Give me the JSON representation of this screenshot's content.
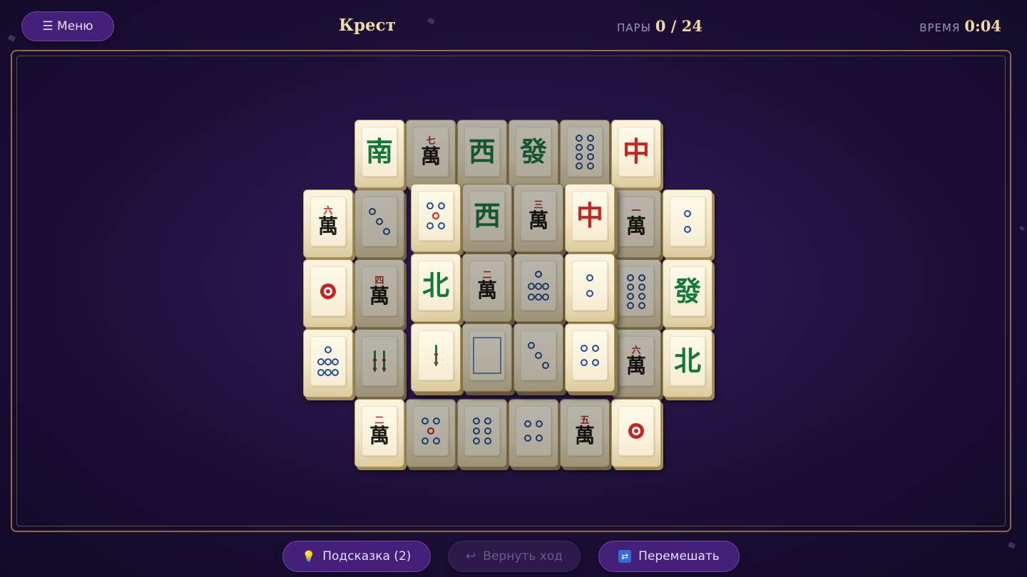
{
  "header": {
    "menu_label": "☰  Меню",
    "title": "Крест",
    "pairs_label": "ПАРЫ",
    "pairs_value": "0 / 24",
    "time_label": "ВРЕМЯ",
    "time_value": "0:04"
  },
  "controls": {
    "hint_icon": "💡",
    "hint_label": "Подсказка (2)",
    "undo_icon": "↩",
    "undo_label": "Вернуть ход",
    "shuffle_icon": "🔀",
    "shuffle_label": "Перемешать"
  },
  "tiles": [
    {
      "col": 1,
      "row": 0,
      "kind": "honor",
      "glyph": "南",
      "color": "green",
      "dim": false
    },
    {
      "col": 2,
      "row": 0,
      "kind": "char",
      "num": "七",
      "dim": true
    },
    {
      "col": 3,
      "row": 0,
      "kind": "honor",
      "glyph": "西",
      "color": "green",
      "dim": true
    },
    {
      "col": 4,
      "row": 0,
      "kind": "honor",
      "glyph": "發",
      "color": "green",
      "dim": true
    },
    {
      "col": 5,
      "row": 0,
      "kind": "dots",
      "n": 8,
      "dim": true
    },
    {
      "col": 6,
      "row": 0,
      "kind": "honor",
      "glyph": "中",
      "color": "red",
      "dim": false
    },
    {
      "col": 0,
      "row": 1,
      "kind": "char",
      "num": "六",
      "dim": false
    },
    {
      "col": 1,
      "row": 1,
      "kind": "dots",
      "n": 3,
      "dim": true
    },
    {
      "col": 6,
      "row": 1,
      "kind": "char",
      "num": "一",
      "dim": true
    },
    {
      "col": 7,
      "row": 1,
      "kind": "dots",
      "n": 2,
      "dim": false
    },
    {
      "col": 0,
      "row": 2,
      "kind": "dots",
      "n": 1,
      "dim": false
    },
    {
      "col": 1,
      "row": 2,
      "kind": "char",
      "num": "四",
      "dim": true
    },
    {
      "col": 6,
      "row": 2,
      "kind": "dots",
      "n": 8,
      "dim": true
    },
    {
      "col": 7,
      "row": 2,
      "kind": "honor",
      "glyph": "發",
      "color": "green",
      "dim": false
    },
    {
      "col": 0,
      "row": 3,
      "kind": "dots",
      "n": 7,
      "dim": false
    },
    {
      "col": 1,
      "row": 3,
      "kind": "bamboo",
      "n": 2,
      "dim": true
    },
    {
      "col": 6,
      "row": 3,
      "kind": "char",
      "num": "六",
      "dim": true
    },
    {
      "col": 7,
      "row": 3,
      "kind": "honor",
      "glyph": "北",
      "color": "green",
      "dim": false
    },
    {
      "col": 1,
      "row": 4,
      "kind": "char",
      "num": "二",
      "dim": false
    },
    {
      "col": 2,
      "row": 4,
      "kind": "dots",
      "n": 5,
      "dim": true
    },
    {
      "col": 3,
      "row": 4,
      "kind": "dots",
      "n": 6,
      "dim": true
    },
    {
      "col": 4,
      "row": 4,
      "kind": "dots",
      "n": 4,
      "dim": true
    },
    {
      "col": 5,
      "row": 4,
      "kind": "char",
      "num": "五",
      "dim": true
    },
    {
      "col": 6,
      "row": 4,
      "kind": "dots",
      "n": 1,
      "dim": false
    },
    {
      "col": 2,
      "row": 1,
      "layer": 1,
      "kind": "dots",
      "n": 5,
      "dim": false
    },
    {
      "col": 3,
      "row": 1,
      "layer": 1,
      "kind": "honor",
      "glyph": "西",
      "color": "green",
      "dim": true
    },
    {
      "col": 4,
      "row": 1,
      "layer": 1,
      "kind": "char",
      "num": "三",
      "dim": true
    },
    {
      "col": 5,
      "row": 1,
      "layer": 1,
      "kind": "honor",
      "glyph": "中",
      "color": "red",
      "dim": false
    },
    {
      "col": 2,
      "row": 2,
      "layer": 1,
      "kind": "honor",
      "glyph": "北",
      "color": "green",
      "dim": false
    },
    {
      "col": 3,
      "row": 2,
      "layer": 1,
      "kind": "char",
      "num": "二",
      "dim": true
    },
    {
      "col": 4,
      "row": 2,
      "layer": 1,
      "kind": "dots",
      "n": 7,
      "dim": true
    },
    {
      "col": 5,
      "row": 2,
      "layer": 1,
      "kind": "dots",
      "n": 2,
      "dim": false
    },
    {
      "col": 2,
      "row": 3,
      "layer": 1,
      "kind": "bamboo",
      "n": 1,
      "dim": false
    },
    {
      "col": 3,
      "row": 3,
      "layer": 1,
      "kind": "white",
      "dim": true
    },
    {
      "col": 4,
      "row": 3,
      "layer": 1,
      "kind": "dots",
      "n": 3,
      "dim": true
    },
    {
      "col": 5,
      "row": 3,
      "layer": 1,
      "kind": "dots",
      "n": 4,
      "dim": false
    }
  ]
}
